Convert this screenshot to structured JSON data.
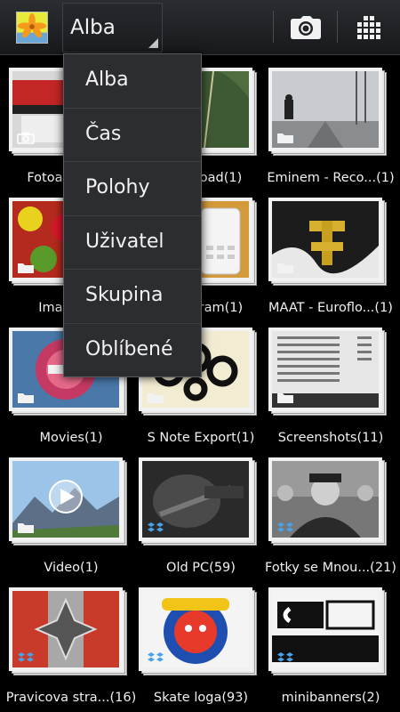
{
  "actionbar": {
    "app_icon": "gallery-flower-icon",
    "selected_view": "Alba",
    "camera_icon": "camera-icon",
    "grid_icon": "grid-view-icon"
  },
  "menu": {
    "items": [
      "Alba",
      "Čas",
      "Polohy",
      "Uživatel",
      "Skupina",
      "Oblíbené"
    ]
  },
  "albums": [
    {
      "label": "Fotoaparát(8)",
      "badge": "camera-badge-icon"
    },
    {
      "label": "Download(1)",
      "badge": "folder-icon"
    },
    {
      "label": "Eminem - Reco...(1)",
      "badge": "folder-icon"
    },
    {
      "label": "Images(2)",
      "badge": "folder-icon"
    },
    {
      "label": "Instagram(1)",
      "badge": "folder-icon"
    },
    {
      "label": "MAAT - Euroflo...(1)",
      "badge": "folder-icon"
    },
    {
      "label": "Movies(1)",
      "badge": "folder-icon"
    },
    {
      "label": "S Note Export(1)",
      "badge": "folder-icon"
    },
    {
      "label": "Screenshots(11)",
      "badge": "folder-icon"
    },
    {
      "label": "Video(1)",
      "badge": "folder-icon"
    },
    {
      "label": "Old PC(59)",
      "badge": "dropbox-icon"
    },
    {
      "label": "Fotky se Mnou...(21)",
      "badge": "dropbox-icon"
    },
    {
      "label": "Pravicova stra...(16)",
      "badge": "dropbox-icon"
    },
    {
      "label": "Skate loga(93)",
      "badge": "dropbox-icon"
    },
    {
      "label": "minibanners(2)",
      "badge": "dropbox-icon"
    }
  ]
}
